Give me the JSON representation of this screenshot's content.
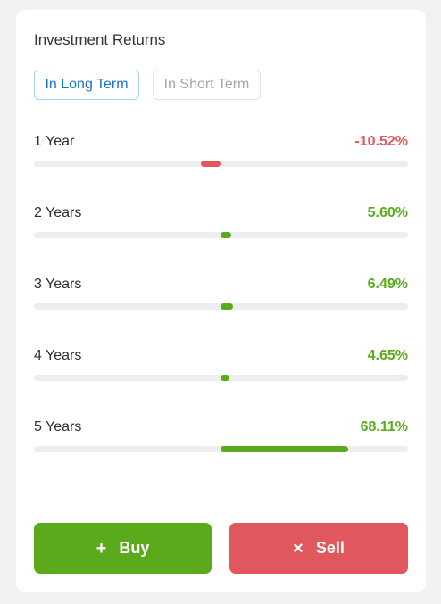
{
  "card": {
    "title": "Investment Returns"
  },
  "tabs": [
    {
      "label": "In Long Term",
      "active": true
    },
    {
      "label": "In Short Term",
      "active": false
    }
  ],
  "returns": [
    {
      "label": "1 Year",
      "value": "-10.52%",
      "percent": -10.52
    },
    {
      "label": "2 Years",
      "value": "5.60%",
      "percent": 5.6
    },
    {
      "label": "3 Years",
      "value": "6.49%",
      "percent": 6.49
    },
    {
      "label": "4 Years",
      "value": "4.65%",
      "percent": 4.65
    },
    {
      "label": "5 Years",
      "value": "68.11%",
      "percent": 68.11
    }
  ],
  "actions": {
    "buy_label": "Buy",
    "buy_icon": "plus-icon",
    "sell_label": "Sell",
    "sell_icon": "close-icon"
  },
  "colors": {
    "positive": "#5aaa1c",
    "negative": "#e0585d",
    "active_tab": "#1a73c9"
  }
}
